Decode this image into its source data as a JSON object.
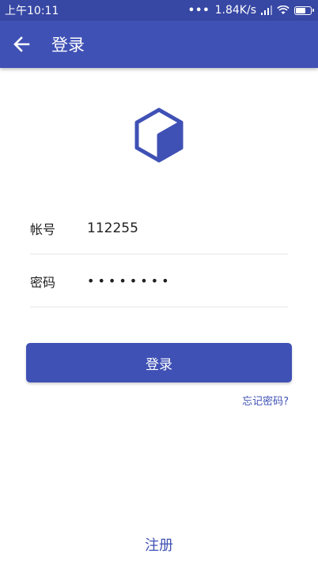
{
  "status_bar": {
    "time": "上午10:11",
    "network_speed": "1.84K/s",
    "icons": [
      "more-dots-icon",
      "signal-icon",
      "wifi-icon",
      "battery-icon"
    ]
  },
  "app_bar": {
    "title": "登录",
    "back_icon": "back-arrow-icon"
  },
  "logo": {
    "icon": "cube-logo-icon",
    "color": "#3f51b5"
  },
  "form": {
    "account_label": "帐号",
    "account_value": "112255",
    "password_label": "密码",
    "password_value": "••••••••"
  },
  "login_button": "登录",
  "forgot_password": "忘记密码?",
  "register": "注册",
  "colors": {
    "primary": "#3f51b5",
    "status_bar": "#3747a4",
    "text": "#212121",
    "divider": "#e6e6e6"
  }
}
